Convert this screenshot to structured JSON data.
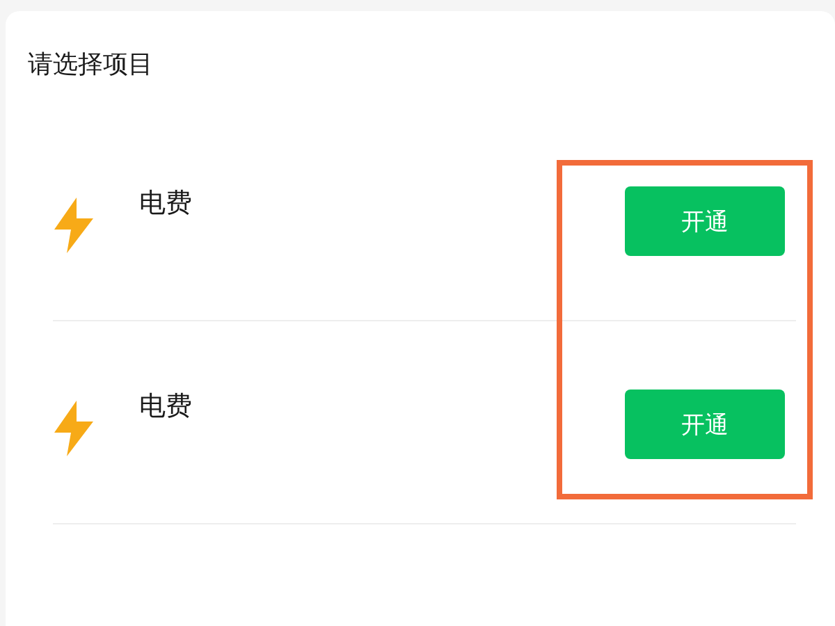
{
  "title": "请选择项目",
  "items": [
    {
      "label": "电费",
      "action": "开通"
    },
    {
      "label": "电费",
      "action": "开通"
    }
  ],
  "highlight_frame": true
}
